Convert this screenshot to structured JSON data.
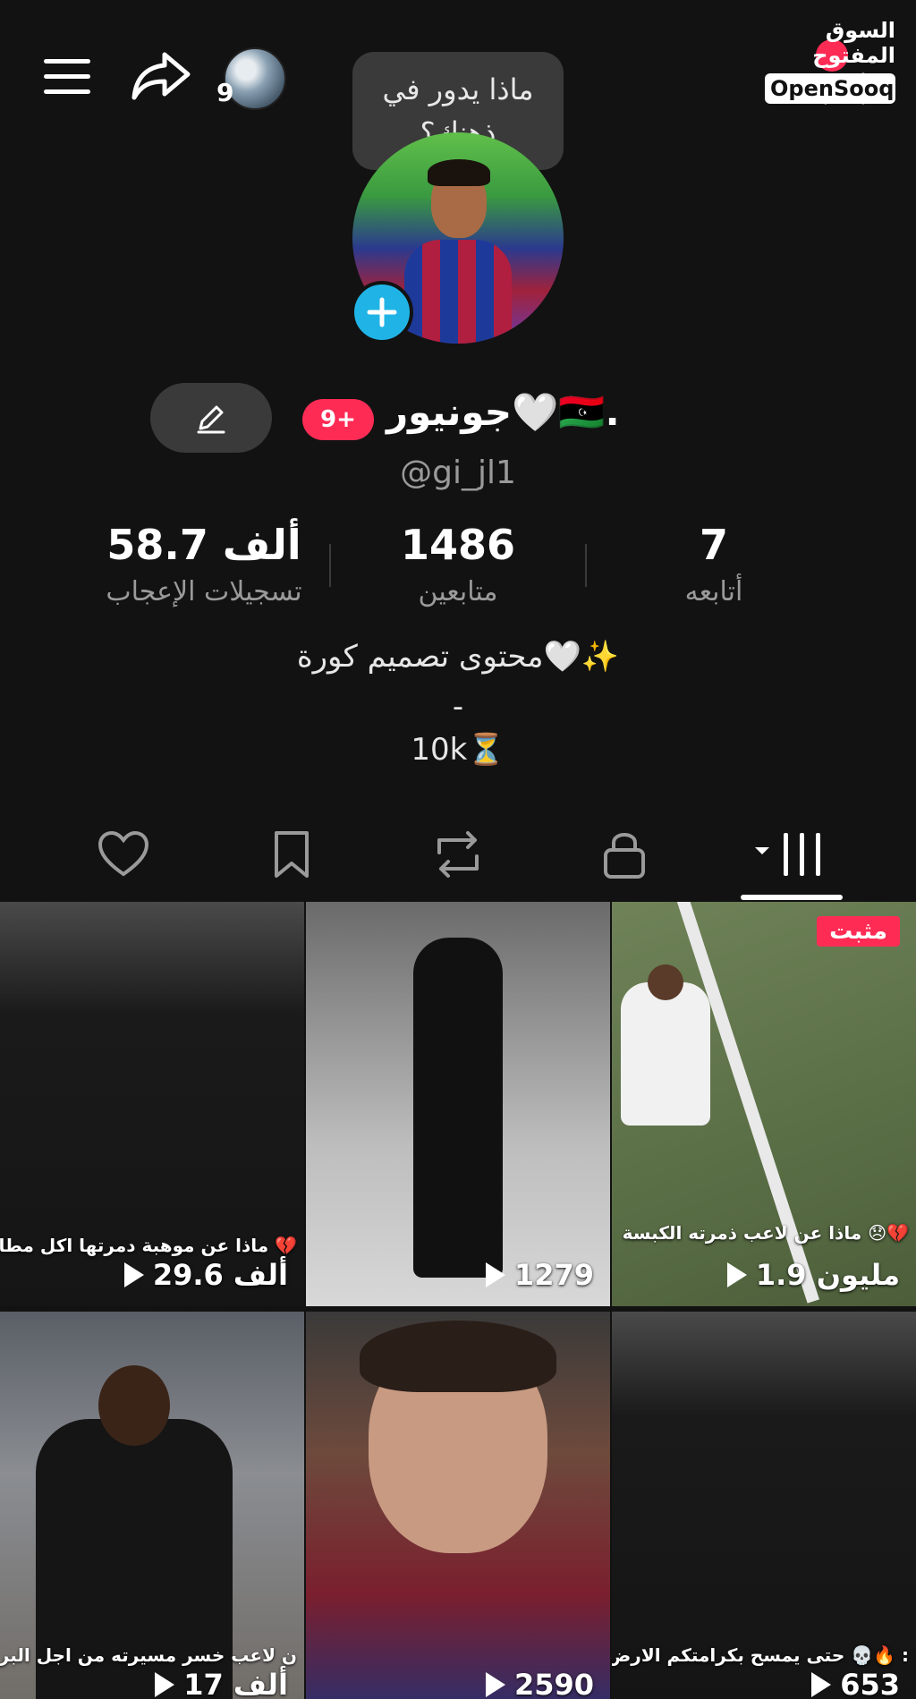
{
  "header": {
    "story_count": "9",
    "thought_bubble": "ماذا يدور في ذهنك؟",
    "logo_arabic": "السوق المفتوح",
    "logo_english": "OpenSooq"
  },
  "profile": {
    "display_name": "جونيور🤍🇱🇾.",
    "badge": "9+",
    "username": "@gi_jl1",
    "stats": {
      "likes": {
        "value": "58.7 ألف",
        "label": "تسجيلات الإعجاب"
      },
      "followers": {
        "value": "1486",
        "label": "متابعين"
      },
      "following": {
        "value": "7",
        "label": "أتابعه"
      }
    },
    "bio": {
      "line1": "محتوى تصميم كورة🤍✨",
      "line2": "-",
      "line3": "10k⏳"
    }
  },
  "tabs": [
    "videos-grid",
    "private",
    "reposts",
    "saved",
    "liked"
  ],
  "videos": [
    {
      "views": "1.9 مليون",
      "caption": "ماذا عن لاعب ذمرته الكبسة 😞💔",
      "pinned_label": "مثبت"
    },
    {
      "views": "1279",
      "caption": ""
    },
    {
      "views": "29.6 ألف",
      "caption": "ماذا عن موهبة دمرتها اكل مطاعم 💔"
    },
    {
      "views": "653",
      "caption": "حتى يمسح بكرامتكم الارض 💀🔥 :"
    },
    {
      "views": "2590",
      "caption": ""
    },
    {
      "views": "17 ألف",
      "caption": "ن لاعب خسر مسيرته من اجل البرجر"
    }
  ],
  "colors": {
    "accent": "#fe2c55",
    "avatar_add": "#20b4e6",
    "background": "#121212"
  }
}
